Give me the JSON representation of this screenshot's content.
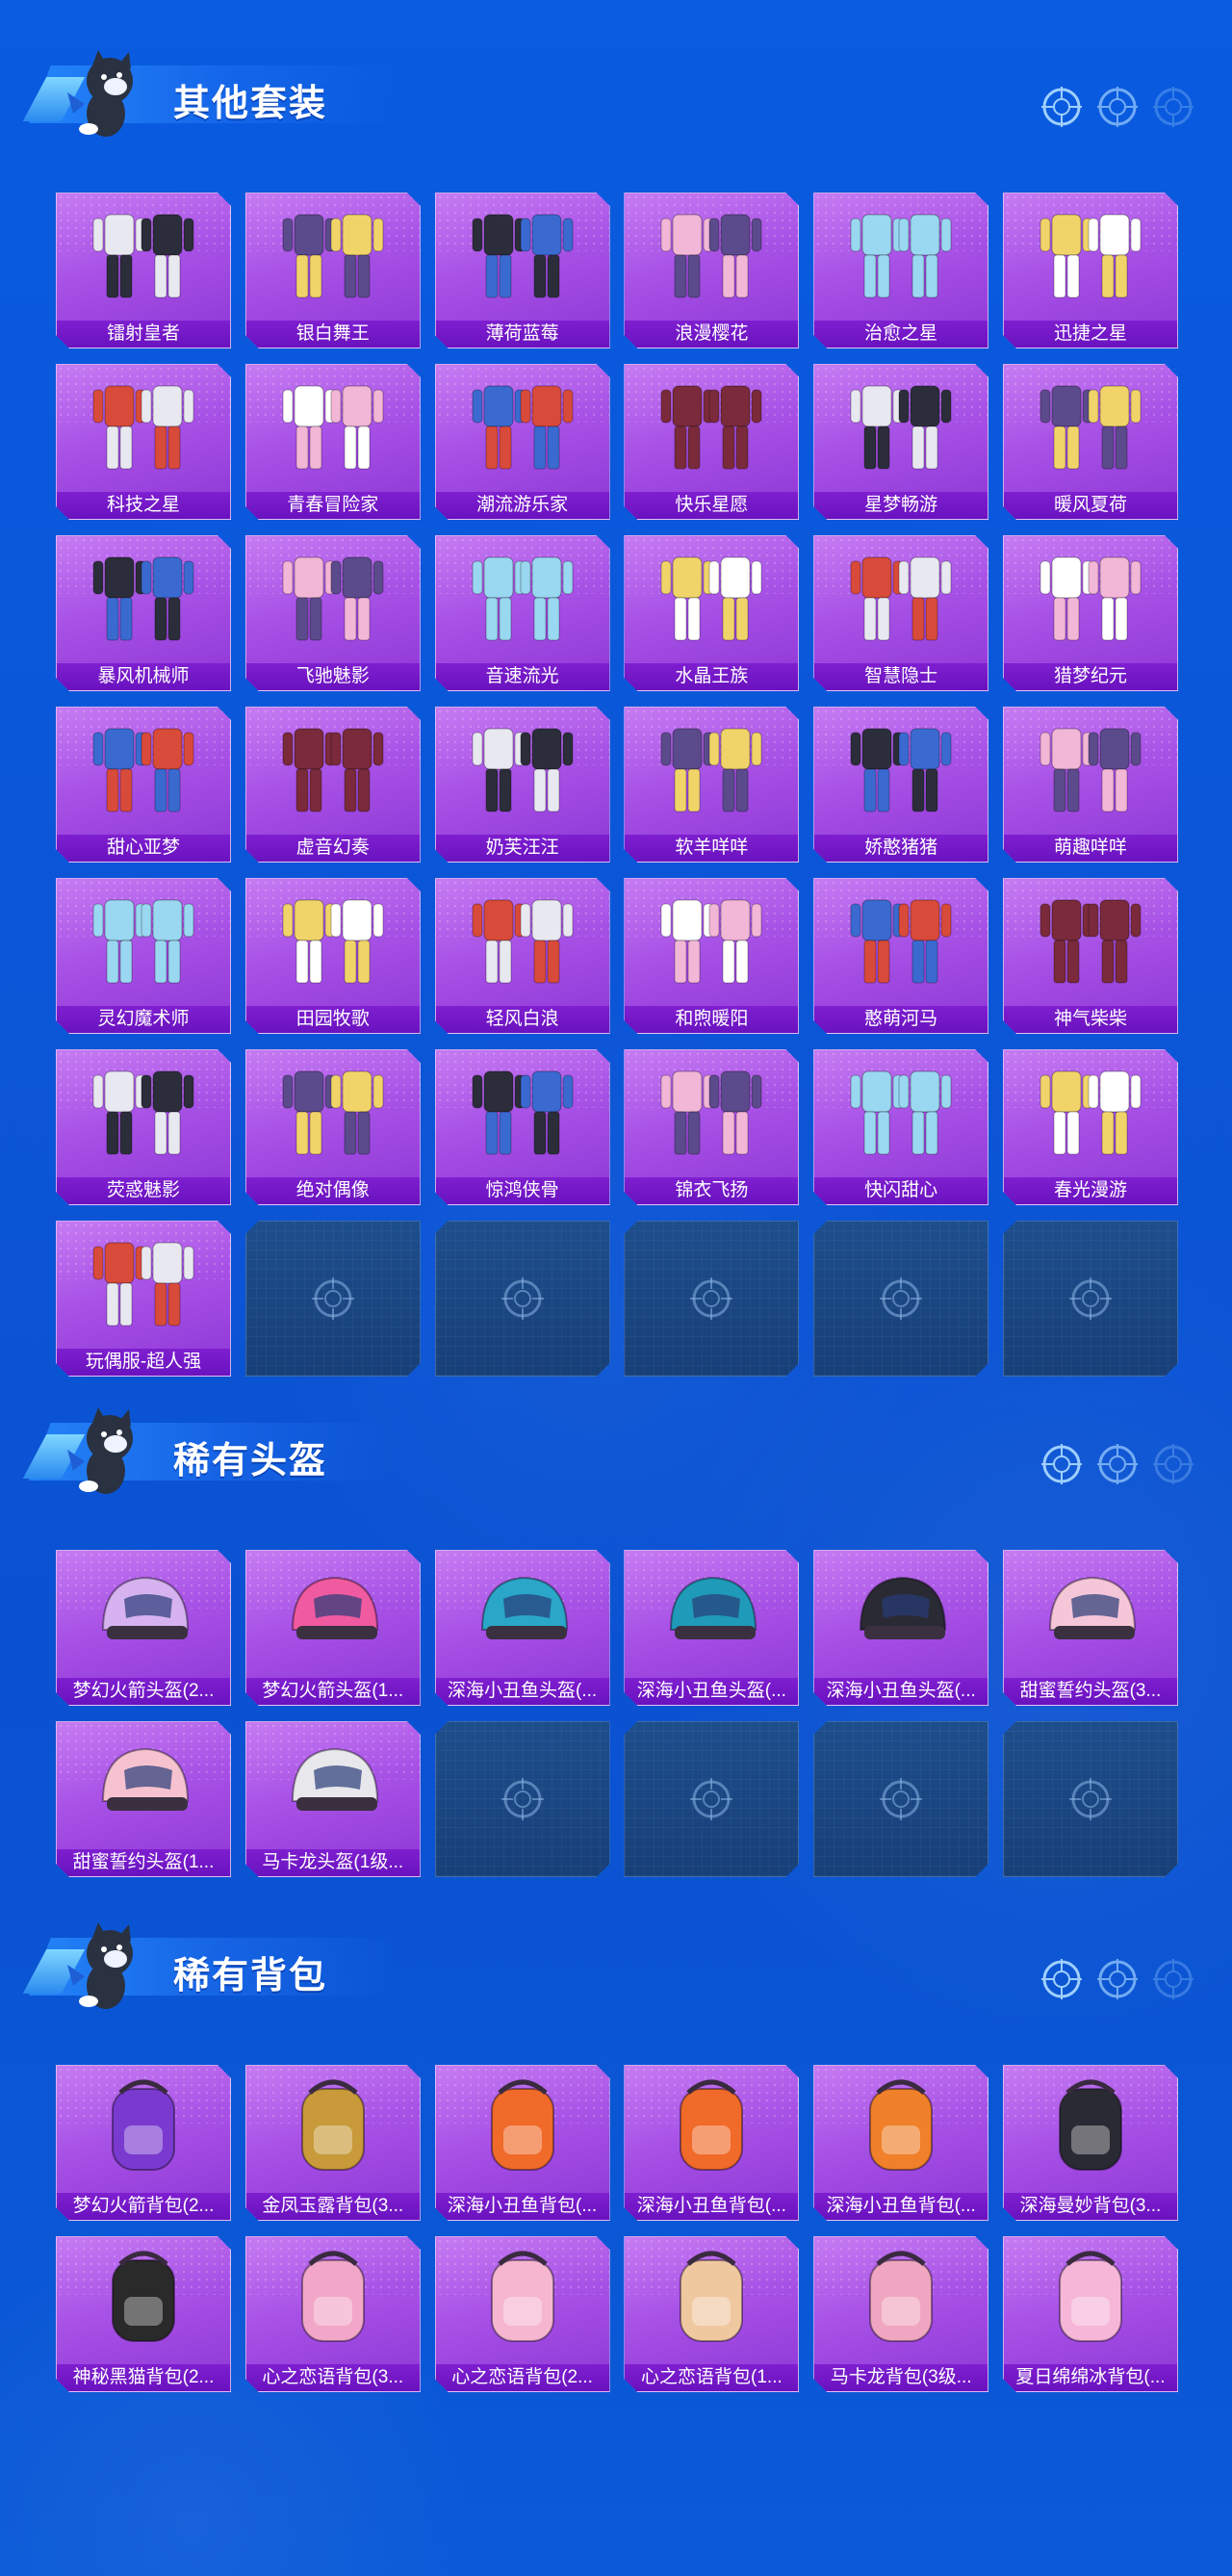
{
  "sections": [
    {
      "title": "其他套装",
      "items": [
        "镭射皇者",
        "银白舞王",
        "薄荷蓝莓",
        "浪漫樱花",
        "治愈之星",
        "迅捷之星",
        "科技之星",
        "青春冒险家",
        "潮流游乐家",
        "快乐星愿",
        "星梦畅游",
        "暖风夏荷",
        "暴风机械师",
        "飞驰魅影",
        "音速流光",
        "水晶王族",
        "智慧隐士",
        "猎梦纪元",
        "甜心亚梦",
        "虚音幻奏",
        "奶芙汪汪",
        "软羊咩咩",
        "娇憨猪猪",
        "萌趣咩咩",
        "灵幻魔术师",
        "田园牧歌",
        "轻风白浪",
        "和煦暖阳",
        "憨萌河马",
        "神气柴柴",
        "荧惑魅影",
        "绝对偶像",
        "惊鸿侠骨",
        "锦衣飞扬",
        "快闪甜心",
        "春光漫游",
        "玩偶服-超人强"
      ],
      "empty_slots": 5
    },
    {
      "title": "稀有头盔",
      "items": [
        "梦幻火箭头盔(2...",
        "梦幻火箭头盔(1...",
        "深海小丑鱼头盔(...",
        "深海小丑鱼头盔(...",
        "深海小丑鱼头盔(...",
        "甜蜜誓约头盔(3...",
        "甜蜜誓约头盔(1...",
        "马卡龙头盔(1级..."
      ],
      "empty_slots": 4
    },
    {
      "title": "稀有背包",
      "items": [
        "梦幻火箭背包(2...",
        "金凤玉露背包(3...",
        "深海小丑鱼背包(...",
        "深海小丑鱼背包(...",
        "深海小丑鱼背包(...",
        "深海曼妙背包(3...",
        "神秘黑猫背包(2...",
        "心之恋语背包(3...",
        "心之恋语背包(2...",
        "心之恋语背包(1...",
        "马卡龙背包(3级...",
        "夏日绵绵冰背包(..."
      ],
      "empty_slots": 0
    }
  ],
  "colors": {
    "background": "#0b56d8",
    "card": "#a751e6",
    "label_bar": "#7e1fd0",
    "empty_slot": "#1d4e8c"
  },
  "icons": {
    "section_header": "mascot-icon",
    "header_decoration": "crosshair-icon",
    "empty_slot": "crosshair-icon"
  }
}
